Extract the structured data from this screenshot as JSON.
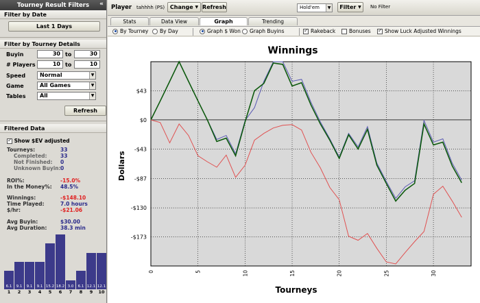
{
  "sidebar": {
    "title": "Tourney Result Filters",
    "collapse_glyph": "«",
    "filter_by_date": {
      "heading": "Filter by Date",
      "button": "Last 1 Days"
    },
    "filter_by_details": {
      "heading": "Filter by Tourney Details",
      "buyin": {
        "label": "Buyin",
        "from": "30",
        "to_label": "to",
        "to": "30"
      },
      "players": {
        "label": "# Players",
        "from": "10",
        "to_label": "to",
        "to": "10"
      },
      "speed": {
        "label": "Speed",
        "value": "Normal"
      },
      "game": {
        "label": "Game",
        "value": "All Games"
      },
      "tables": {
        "label": "Tables",
        "value": "All"
      },
      "refresh": "Refresh"
    },
    "filtered_data": {
      "heading": "Filtered Data",
      "show_ev": "Show $EV adjusted",
      "tourneys_label": "Tourneys:",
      "tourneys": "33",
      "completed_label": "Completed:",
      "completed": "33",
      "not_finished_label": "Not Finished:",
      "not_finished": "0",
      "unknown_buyin_label": "Unknown Buyin:",
      "unknown_buyin": "0",
      "roi_label": "ROI%:",
      "roi": "-15.0%",
      "itm_label": "In the Money%:",
      "itm": "48.5%",
      "winnings_label": "Winnings:",
      "winnings": "-$148.10",
      "time_label": "Time Played:",
      "time": "7.0 hours",
      "per_hour_label": "$/hr:",
      "per_hour": "-$21.06",
      "avg_buyin_label": "Avg Buyin:",
      "avg_buyin": "$30.00",
      "avg_duration_label": "Avg Duration:",
      "avg_duration": "38.3 min"
    },
    "histogram": {
      "categories": [
        "1",
        "2",
        "3",
        "4",
        "5",
        "6",
        "7",
        "8",
        "9",
        "10"
      ],
      "values": [
        6.1,
        9.1,
        9.1,
        9.1,
        15.2,
        18.2,
        3.0,
        6.1,
        12.1,
        12.1
      ],
      "labels": [
        "6.1",
        "9.1",
        "9.1",
        "9.1",
        "15.2",
        "18.2",
        "3.0",
        "6.1",
        "12.1",
        "12.1"
      ],
      "color": "#3c3a8a"
    }
  },
  "topbar": {
    "player_label": "Player",
    "player_name": "tahhhh (PS)",
    "change": "Change",
    "refresh": "Refresh",
    "game_select": "Hold'em",
    "filter": "Filter",
    "no_filter": "No Filter"
  },
  "tabs": [
    "Stats",
    "Data View",
    "Graph",
    "Trending"
  ],
  "active_tab": "Graph",
  "options": {
    "by_tourney": "By Tourney",
    "by_day": "By Day",
    "graph_won": "Graph $ Won",
    "graph_buyins": "Graph Buyins",
    "rakeback": "Rakeback",
    "bonuses": "Bonuses",
    "show_luck": "Show Luck Adjusted Winnings"
  },
  "chart_data": {
    "type": "line",
    "title": "Winnings",
    "xlabel": "Tourneys",
    "ylabel": "Dollars",
    "xlim": [
      0,
      34
    ],
    "ylim": [
      -216,
      86
    ],
    "yticks": [
      43,
      0,
      -43,
      -87,
      -130,
      -173
    ],
    "ytick_labels": [
      "$43",
      "$0",
      "-$43",
      "-$87",
      "-$130",
      "-$173"
    ],
    "xticks": [
      0,
      5,
      10,
      15,
      20,
      25,
      30
    ],
    "grid": true,
    "x": [
      0,
      1,
      2,
      3,
      4,
      5,
      6,
      7,
      8,
      9,
      10,
      11,
      12,
      13,
      14,
      15,
      16,
      17,
      18,
      19,
      20,
      21,
      22,
      23,
      24,
      25,
      26,
      27,
      28,
      29,
      30,
      31,
      32,
      33
    ],
    "series": [
      {
        "color": "#5a5ab4",
        "values": [
          0,
          28,
          57,
          86,
          57,
          28,
          0,
          -29,
          -23,
          -50,
          -1,
          18,
          57,
          86,
          86,
          57,
          60,
          26,
          -3,
          -28,
          -55,
          -20,
          -40,
          -10,
          -64,
          -91,
          -116,
          -99,
          -90,
          -1,
          -33,
          -28,
          -64,
          -89
        ]
      },
      {
        "color": "#0e5a0e",
        "values": [
          0,
          28,
          57,
          86,
          57,
          28,
          0,
          -32,
          -27,
          -53,
          -3,
          43,
          54,
          84,
          82,
          50,
          55,
          22,
          -6,
          -30,
          -57,
          -22,
          -43,
          -14,
          -67,
          -94,
          -120,
          -104,
          -94,
          -6,
          -37,
          -33,
          -68,
          -93
        ]
      },
      {
        "color": "#e05050",
        "values": [
          0,
          -4,
          -34,
          -6,
          -23,
          -53,
          -62,
          -70,
          -52,
          -85,
          -67,
          -30,
          -20,
          -12,
          -8,
          -7,
          -15,
          -48,
          -71,
          -100,
          -118,
          -172,
          -178,
          -168,
          -190,
          -210,
          -213,
          -196,
          -180,
          -165,
          -110,
          -98,
          -120,
          -144
        ]
      }
    ]
  }
}
